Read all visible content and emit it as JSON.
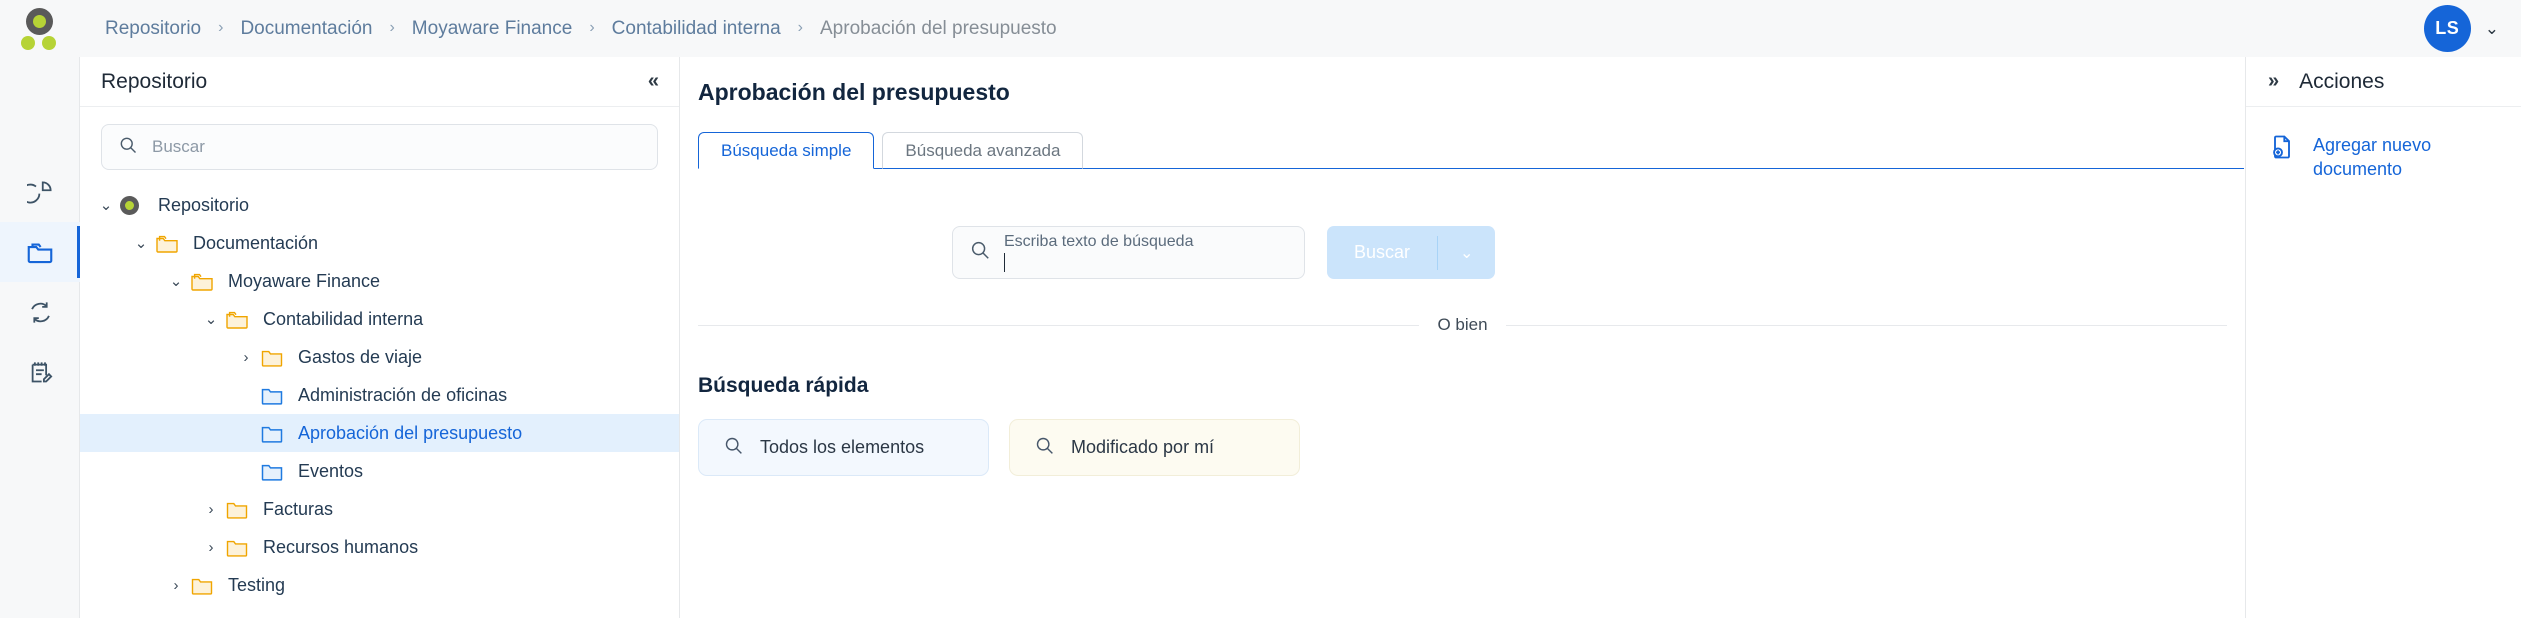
{
  "topbar": {
    "logo_name": "moyaware-logo",
    "breadcrumb": [
      {
        "label": "Repositorio",
        "current": false
      },
      {
        "label": "Documentación",
        "current": false
      },
      {
        "label": "Moyaware Finance",
        "current": false
      },
      {
        "label": "Contabilidad interna",
        "current": false
      },
      {
        "label": "Aprobación del presupuesto",
        "current": true
      }
    ],
    "separator": "›",
    "avatar_initials": "LS",
    "avatar_caret": "⌄",
    "avatar_color": "#1565d8"
  },
  "rail": {
    "items": [
      {
        "icon": "pie-chart-icon",
        "active": false
      },
      {
        "icon": "folder-icon",
        "active": true
      },
      {
        "icon": "sync-refresh-icon",
        "active": false
      },
      {
        "icon": "notepad-edit-icon",
        "active": false
      }
    ]
  },
  "sidebar": {
    "title": "Repositorio",
    "collapse_label": "«",
    "search": {
      "placeholder": "Buscar",
      "value": "",
      "icon": "search-icon"
    },
    "tree": [
      {
        "label": "Repositorio",
        "depth": 0,
        "twisty": "⌄",
        "icon": "repository-dot-icon",
        "selected": false
      },
      {
        "label": "Documentación",
        "depth": 1,
        "twisty": "⌄",
        "icon": "folder-open-icon",
        "selected": false
      },
      {
        "label": "Moyaware Finance",
        "depth": 2,
        "twisty": "⌄",
        "icon": "folder-open-icon",
        "selected": false
      },
      {
        "label": "Contabilidad interna",
        "depth": 3,
        "twisty": "⌄",
        "icon": "folder-open-icon",
        "selected": false
      },
      {
        "label": "Gastos de viaje",
        "depth": 4,
        "twisty": "›",
        "icon": "folder-closed-icon",
        "selected": false
      },
      {
        "label": "Administración de oficinas",
        "depth": 4,
        "twisty": "",
        "icon": "folder-blue-icon",
        "selected": false
      },
      {
        "label": "Aprobación del presupuesto",
        "depth": 4,
        "twisty": "",
        "icon": "folder-blue-icon",
        "selected": true
      },
      {
        "label": "Eventos",
        "depth": 4,
        "twisty": "",
        "icon": "folder-blue-icon",
        "selected": false
      },
      {
        "label": "Facturas",
        "depth": 3,
        "twisty": "›",
        "icon": "folder-closed-icon",
        "selected": false
      },
      {
        "label": "Recursos humanos",
        "depth": 3,
        "twisty": "›",
        "icon": "folder-closed-icon",
        "selected": false
      },
      {
        "label": "Testing",
        "depth": 2,
        "twisty": "›",
        "icon": "folder-closed-icon",
        "selected": false
      }
    ]
  },
  "main": {
    "page_title": "Aprobación del presupuesto",
    "tabs": [
      {
        "label": "Búsqueda simple",
        "active": true
      },
      {
        "label": "Búsqueda avanzada",
        "active": false
      }
    ],
    "search": {
      "label": "Escriba texto de búsqueda",
      "value": "",
      "icon": "search-icon",
      "button_label": "Buscar",
      "button_caret": "⌄",
      "button_color": "#cbe4fb"
    },
    "or_text": "O bien",
    "quick_title": "Búsqueda rápida",
    "quick_cards": [
      {
        "label": "Todos los elementos",
        "icon": "search-icon",
        "tone": "blue"
      },
      {
        "label": "Modificado por mí",
        "icon": "search-icon",
        "tone": "cream"
      }
    ]
  },
  "rightpanel": {
    "expand_label": "»",
    "title": "Acciones",
    "action_label": "Agregar nuevo documento",
    "action_icon": "document-add-icon"
  }
}
